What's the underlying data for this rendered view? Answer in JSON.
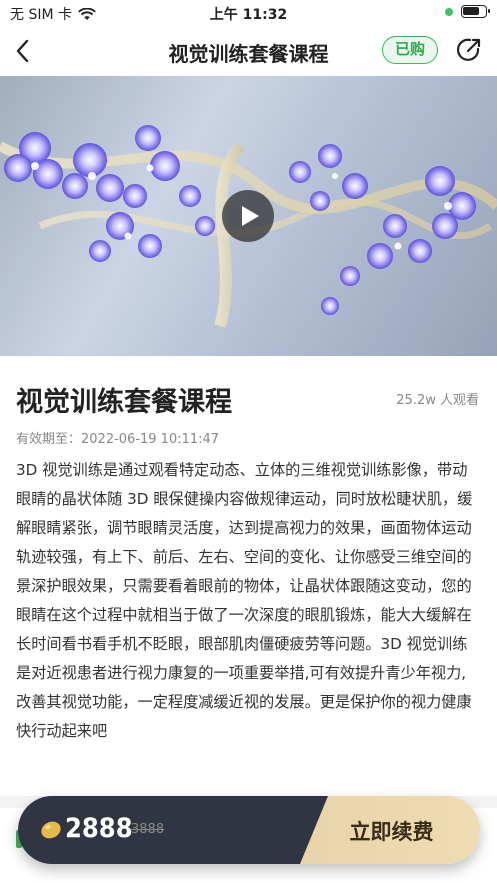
{
  "status_bar": {
    "carrier": "无 SIM 卡",
    "time": "上午 11:32"
  },
  "nav": {
    "title": "视觉训练套餐课程",
    "purchased_label": "已购",
    "icons": {
      "back": "chevron-left-icon",
      "share": "share-icon"
    }
  },
  "video": {
    "play_icon": "play-icon"
  },
  "course": {
    "title": "视觉训练套餐课程",
    "views": "25.2w 人观看",
    "validity": "有效期至：2022-06-19 10:11:47",
    "description": "3D 视觉训练是通过观看特定动态、立体的三维视觉训练影像，带动眼睛的晶状体随 3D 眼保健操内容做规律运动，同时放松睫状肌，缓解眼睛紧张，调节眼睛灵活度，达到提高视力的效果，画面物体运动轨迹较强，有上下、前后、左右、空间的变化、让你感受三维空间的景深护眼效果，只需要看着眼前的物体，让晶状体跟随这变动，您的眼睛在这个过程中就相当于做了一次深度的眼肌锻炼，能大大缓解在长时间看书看手机不眨眼，眼部肌肉僵硬疲劳等问题。3D 视觉训练是对近视患者进行视力康复的一项重要举措,可有效提升青少年视力,改善其视觉功能，一定程度减缓近视的发展。更是保护你的视力健康快行动起来吧"
  },
  "buy_bar": {
    "price": "2888",
    "old_price": "3888",
    "action": "立即续费"
  },
  "colors": {
    "accent_green": "#3eb55b",
    "bar_dark": "#313442",
    "bar_gold": "#ecd8ad"
  }
}
